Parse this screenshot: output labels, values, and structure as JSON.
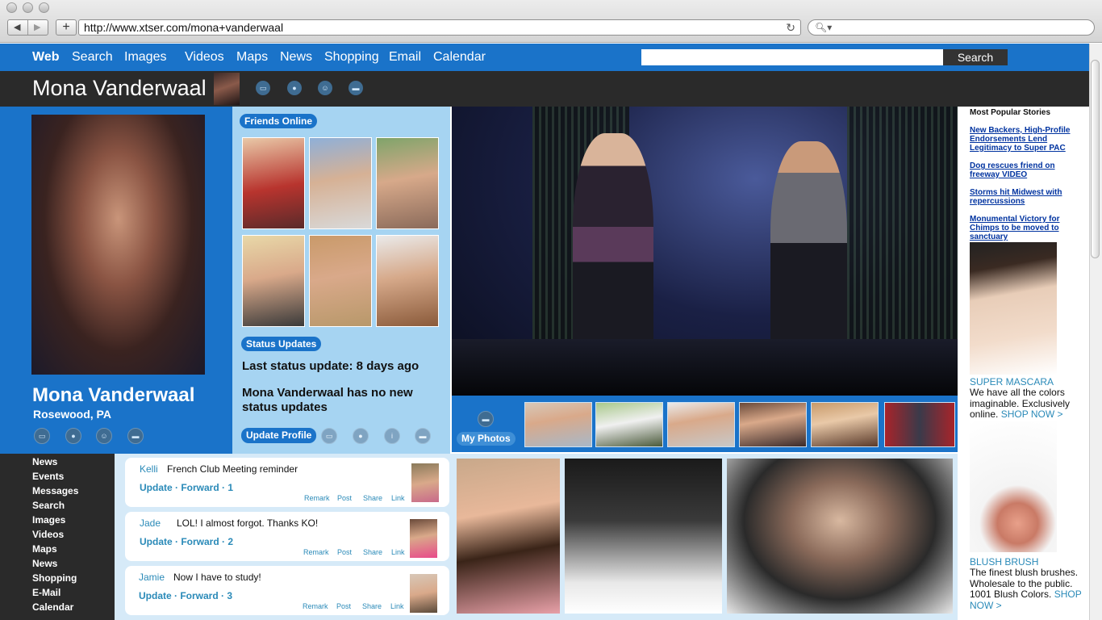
{
  "browser": {
    "url": "http://www.xtser.com/mona+vanderwaal",
    "back_label": "◀",
    "forward_label": "▶",
    "new_tab_label": "+",
    "reload_label": "↻",
    "search_glyph": "🔍︎▾"
  },
  "topnav": {
    "items": [
      "Web",
      "Search",
      "Images",
      "Videos",
      "Maps",
      "News",
      "Shopping",
      "Email",
      "Calendar"
    ],
    "search_button": "Search",
    "search_value": ""
  },
  "profile": {
    "name": "Mona Vanderwaal",
    "location": "Rosewood, PA",
    "icons": [
      "chat-icon",
      "record-icon",
      "users-icon",
      "folder-icon"
    ]
  },
  "friends": {
    "heading": "Friends Online",
    "count": 6
  },
  "status": {
    "heading": "Status Updates",
    "last_update": "Last status update:  8 days ago",
    "no_updates": "Mona Vanderwaal has no new status updates",
    "update_profile": "Update Profile"
  },
  "photos": {
    "label": "My Photos",
    "thumb_count": 7
  },
  "popular": {
    "heading": "Most Popular Stories",
    "stories": [
      "New Backers, High-Profile Endorsements Lend Legitimacy to Super PAC",
      "Dog rescues friend on freeway VIDEO",
      "Storms hit Midwest with repercussions",
      "Monumental Victory for Chimps to be moved to sanctuary"
    ]
  },
  "ads": [
    {
      "title": "SUPER MASCARA",
      "text": "We have all the colors imaginable. Exclusively online.",
      "cta": "SHOP NOW >"
    },
    {
      "title": "BLUSH BRUSH",
      "text": "The finest blush brushes. Wholesale to the public. 1001 Blush Colors.",
      "cta": "SHOP NOW >"
    }
  ],
  "leftnav": {
    "items": [
      "News",
      "Events",
      "Messages",
      "Search",
      "Images",
      "Videos",
      "Maps",
      "News",
      "Shopping",
      "E-Mail",
      "Calendar"
    ]
  },
  "feed": [
    {
      "name": "Kelli",
      "message": "French Club Meeting reminder",
      "actions": "Update · Forward · 1",
      "links": [
        "Remark",
        "Post",
        "Share",
        "Link"
      ]
    },
    {
      "name": "Jade",
      "message": "LOL! I almost forgot. Thanks KO!",
      "actions": "Update · Forward · 2",
      "links": [
        "Remark",
        "Post",
        "Share",
        "Link"
      ]
    },
    {
      "name": "Jamie",
      "message": "Now I have to study!",
      "actions": "Update · Forward · 3",
      "links": [
        "Remark",
        "Post",
        "Share",
        "Link"
      ]
    }
  ],
  "colors": {
    "brand_blue": "#1a73c9",
    "light_blue": "#a6d4f2",
    "dark_bar": "#2a2a2a",
    "link_blue": "#2a8ab8"
  }
}
